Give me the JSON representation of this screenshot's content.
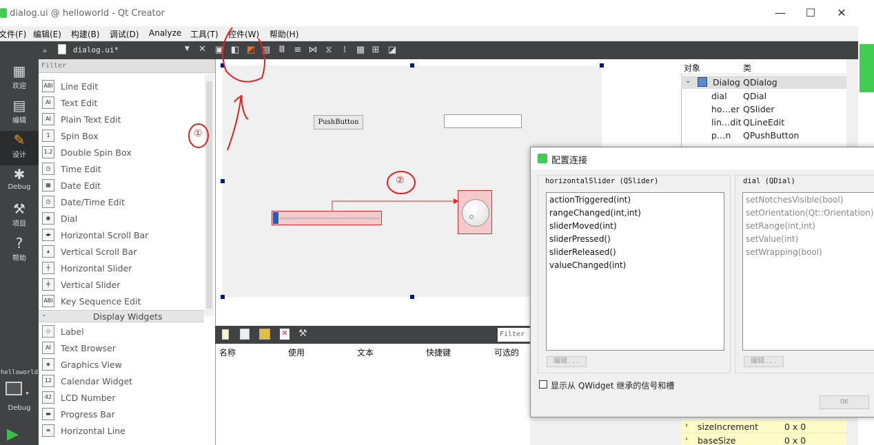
{
  "window": {
    "title": "dialog.ui @ helloworld - Qt Creator",
    "min": "—",
    "max": "☐",
    "close": "✕"
  },
  "menu": [
    "文件(F)",
    "编辑(E)",
    "构建(B)",
    "调试(D)",
    "Analyze",
    "工具(T)",
    "控件(W)",
    "帮助(H)"
  ],
  "modes": [
    {
      "label": "欢迎",
      "icon": "grid-icon"
    },
    {
      "label": "编辑",
      "icon": "edit-icon"
    },
    {
      "label": "设计",
      "icon": "pencil-icon"
    },
    {
      "label": "Debug",
      "icon": "bug-icon"
    },
    {
      "label": "项目",
      "icon": "wrench-icon"
    },
    {
      "label": "帮助",
      "icon": "help-icon"
    }
  ],
  "target": {
    "project": "helloworld",
    "mode": "Debug"
  },
  "editor": {
    "filename": "dialog.ui*"
  },
  "widgetbox": {
    "filter": "Filter",
    "items1": [
      "Line Edit",
      "Text Edit",
      "Plain Text Edit",
      "Spin Box",
      "Double Spin Box",
      "Time Edit",
      "Date Edit",
      "Date/Time Edit",
      "Dial",
      "Horizontal Scroll Bar",
      "Vertical Scroll Bar",
      "Horizontal Slider",
      "Vertical Slider",
      "Key Sequence Edit"
    ],
    "icons1": [
      "ABI",
      "AI",
      "AI",
      "1",
      "1.2",
      "◷",
      "▦",
      "◷",
      "◉",
      "◂▸",
      "▴",
      "┼",
      "╪",
      "ABI"
    ],
    "category": "Display Widgets",
    "items2": [
      "Label",
      "Text Browser",
      "Graphics View",
      "Calendar Widget",
      "LCD Number",
      "Progress Bar",
      "Horizontal Line"
    ],
    "icons2": [
      "◇",
      "AI",
      "◈",
      "12",
      "42",
      "▬",
      "≡"
    ]
  },
  "form": {
    "pushbutton": "PushButton"
  },
  "signals_editor": {
    "filter": "Filter",
    "columns": [
      "名称",
      "使用",
      "文本",
      "快捷键",
      "可选的"
    ]
  },
  "object_inspector": {
    "col_object": "对象",
    "col_class": "类",
    "rows": [
      {
        "obj": "Dialog",
        "cls": "QDialog"
      },
      {
        "obj": "dial",
        "cls": "QDial"
      },
      {
        "obj": "ho…er",
        "cls": "QSlider"
      },
      {
        "obj": "lin…dit",
        "cls": "QLineEdit"
      },
      {
        "obj": "p…n",
        "cls": "QPushButton"
      }
    ]
  },
  "properties": [
    {
      "name": "sizeIncrement",
      "value": "0 x 0"
    },
    {
      "name": "baseSize",
      "value": "0 x 0"
    }
  ],
  "dialog": {
    "title": "配置连接",
    "left_title": "horizontalSlider (QSlider)",
    "left_items": [
      "actionTriggered(int)",
      "rangeChanged(int,int)",
      "sliderMoved(int)",
      "sliderPressed()",
      "sliderReleased()",
      "valueChanged(int)"
    ],
    "right_title": "dial (QDial)",
    "right_items": [
      "setNotchesVisible(bool)",
      "setOrientation(Qt::Orientation)",
      "setRange(int,int)",
      "setValue(int)",
      "setWrapping(bool)"
    ],
    "edit_label": "编辑...",
    "checkbox": "显示从 QWidget 继承的信号和槽",
    "ok": "OK"
  },
  "annotations": [
    "①",
    "②"
  ],
  "colors": {
    "dark": "#404244",
    "accent": "#d03030",
    "selection": "#001a80"
  }
}
